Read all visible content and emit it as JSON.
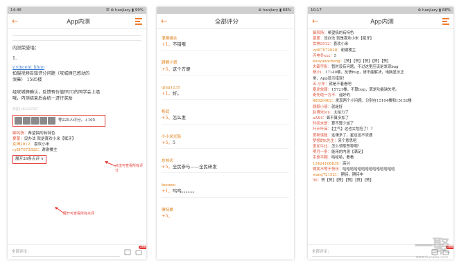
{
  "phone1": {
    "status": {
      "time": "14:46",
      "right": "☰ ⊕ hanjiary ▮ 99%"
    },
    "title": "App内测",
    "lines": {
      "l1": "内测荣誉墙：",
      "l2": "1.",
      "l3": "v.vincent_khoo",
      "l4": "拍摄视频告知评分问题（攻城狮已感动的",
      "l5": "哭晕）          1585楼",
      "l6": "经攻城狮确认，反馈有价值BUG的同学会上墙",
      "l7": "哦，内测结束后会统一进行奖励",
      "meta": "浏览1181247857"
    },
    "likes": {
      "text": "等225人评分，+105"
    },
    "annot1": "点击可查看所有评分",
    "comments": [
      {
        "user": "御风扬：",
        "text": "希望搞的有特色"
      },
      {
        "user": "夏蒙：",
        "text": "设办法 就是喜欢小米【赋牙】"
      },
      {
        "user": "女神2012：",
        "text": "喜欢小米"
      },
      {
        "user": "cyl87072828：",
        "text": "谢谢楼主"
      }
    ],
    "expand": "展开26条点评 ∨",
    "annot2": "展开可查看所有点评",
    "bar": {
      "label": "全部评论：",
      "badge": "288"
    }
  },
  "phone2": {
    "status": {
      "time": "",
      "right": "⊕ hanjiary ▮ 68%"
    },
    "title": "全部评分",
    "items": [
      {
        "user": "混猴组合",
        "score": "+1，",
        "text": "不错哦"
      },
      {
        "user": "顾顾小哥",
        "score": "+5，",
        "text": "这个方便"
      },
      {
        "user": "qing1235",
        "score": "+1，",
        "text": "好。"
      },
      {
        "user": "杨武",
        "score": "+5，",
        "text": "怎么发"
      },
      {
        "user": "小小米光船",
        "score": "+5，",
        "text": "5"
      },
      {
        "user": "东邦代",
        "score": "+5，",
        "text": "全民参与——全民研发"
      },
      {
        "user": "hooxoo",
        "score": "+1，",
        "text": "呜呜。。。。。。"
      },
      {
        "user": "傅特果",
        "score": "+5，",
        "text": ""
      }
    ]
  },
  "phone3": {
    "status": {
      "time": "10:17",
      "right": "⊕ hanjiary ▮ 68%"
    },
    "title": "App内测",
    "comments": [
      {
        "user": "御风扬：",
        "text": "希望搞的有特色"
      },
      {
        "user": "夏蒙：",
        "text": "设办法 就是喜欢小米【赋牙】"
      },
      {
        "user": "女神2012：",
        "text": "喜欢小米"
      },
      {
        "user": "cyl87072828：",
        "text": "谢谢楼主"
      },
      {
        "user": "闪电冬xxx：",
        "text": "5"
      },
      {
        "user": "kouyuancheng：",
        "text": "【赞】【赞】【赞】【赞】【赞】"
      },
      {
        "user": "夫霸字影：",
        "text": "暂时没有问题，不过这里应该是发现bug"
      },
      {
        "user": "杨小i：",
        "text": "17140楼，反馈bug，请不能解决，电脑显示正"
      },
      {
        "user": "",
        "text": "常，App显示错误！"
      },
      {
        "user": "五-小东：",
        "text": "就是不着看吧"
      },
      {
        "user": "夏途效骤：",
        "text": "15721楼，不算bug，算是功能缺失吧。"
      },
      {
        "user": "奇先绝一方不：",
        "text": "谣好的"
      },
      {
        "user": "48520402：",
        "text": "发现两个小问题，分别在15104楼和15152楼"
      },
      {
        "user": "顾顾小哥：",
        "text": "就是好"
      },
      {
        "user": "赵博米fen：",
        "text": "太给力了"
      },
      {
        "user": "aAX4：",
        "text": "算不算多加了"
      },
      {
        "user": "时间未是：",
        "text": "算不算少加了"
      },
      {
        "user": "叶计叶茹：",
        "text": "【生气】这也太危险了！？"
      },
      {
        "user": "爱新溪菇：",
        "text": "这谦多了，星这这不流通"
      },
      {
        "user": "梦想的K先生：",
        "text": "来个意思吧"
      },
      {
        "user": "爱如牛比：",
        "text": "怎么领取赞称啊！"
      },
      {
        "user": "明月一条：",
        "text": "能用的内测【满足】"
      },
      {
        "user": "手旅平胸：",
        "text": "哈哈哈，看看"
      },
      {
        "user": "13424106838：",
        "text": "高兴"
      },
      {
        "user": "微笑不等于快乐：",
        "text": "哈哈哈哈哈哈哈哈哈哈哈哈哈哈"
      },
      {
        "user": "wang721521：",
        "text": "期待，期待中"
      },
      {
        "user": "56：",
        "text": "赞【赞】【赞】【赞】【赞】【赞】"
      }
    ],
    "bar": {
      "label": "全部评论：",
      "badge": "288"
    }
  },
  "watermark": {
    "big": "一聚",
    "small": "www.xiazaiba.com"
  }
}
